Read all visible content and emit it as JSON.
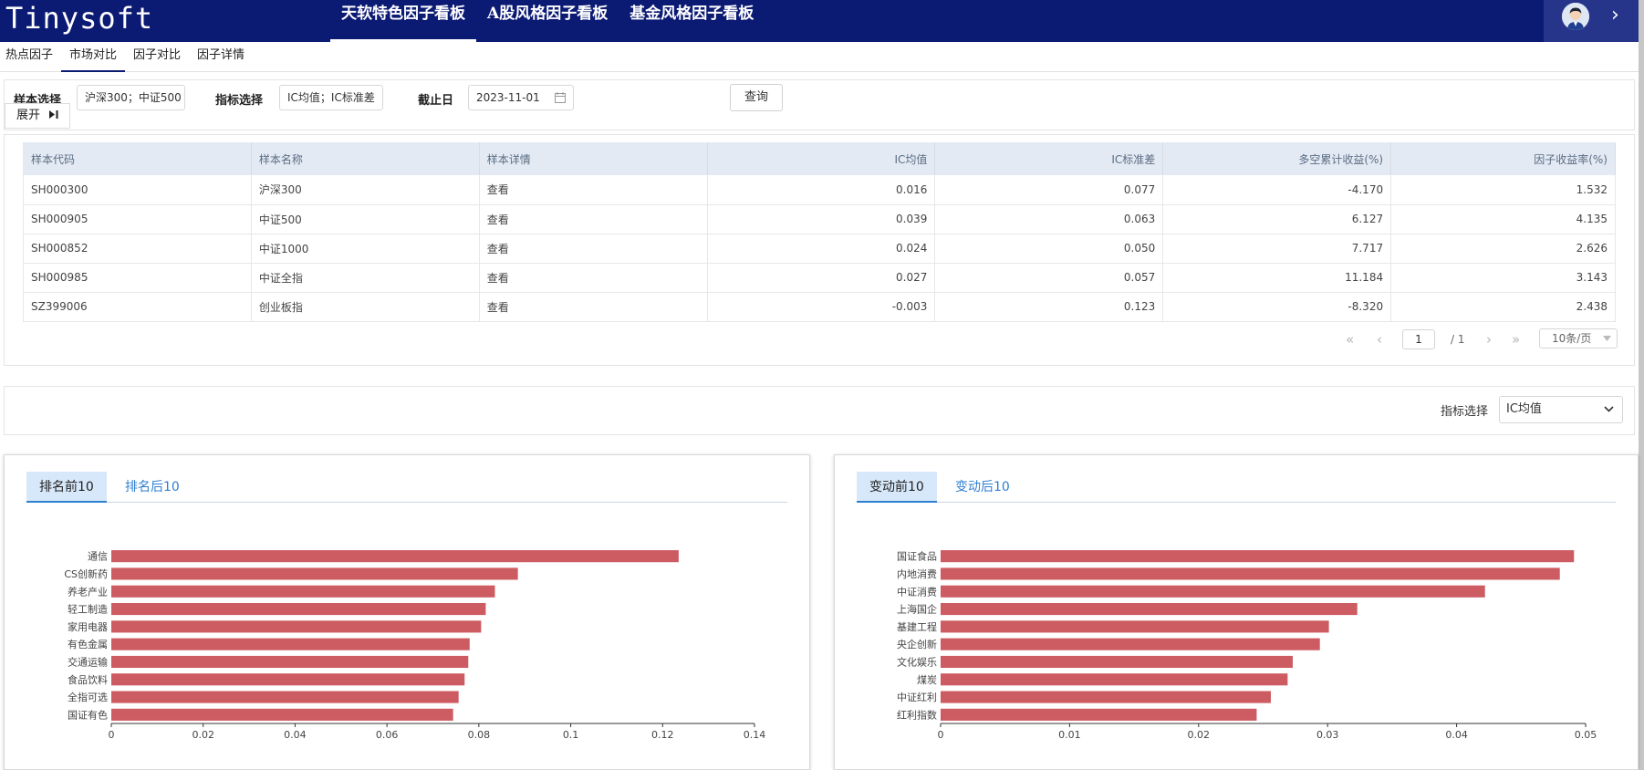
{
  "app": {
    "logo": "Tinysoft"
  },
  "nav": [
    {
      "label": "天软特色因子看板"
    },
    {
      "label": "A股风格因子看板"
    },
    {
      "label": "基金风格因子看板"
    }
  ],
  "subtabs": [
    {
      "label": "热点因子"
    },
    {
      "label": "市场对比"
    },
    {
      "label": "因子对比"
    },
    {
      "label": "因子详情"
    }
  ],
  "filters": {
    "sample_label": "样本选择",
    "sample_value": "沪深300；中证500",
    "metric_label": "指标选择",
    "metric_value": "IC均值；IC标准差",
    "date_label": "截止日",
    "date_value": "2023-11-01",
    "query_button": "查询",
    "expand_label": "展开"
  },
  "table": {
    "headers": [
      "样本代码",
      "样本名称",
      "样本详情",
      "IC均值",
      "IC标准差",
      "多空累计收益(%)",
      "因子收益率(%)"
    ],
    "rows": [
      {
        "code": "SH000300",
        "name": "沪深300",
        "detail": "查看",
        "ic_mean": "0.016",
        "ic_std": "0.077",
        "ls_return": "-4.170",
        "factor_return": "1.532"
      },
      {
        "code": "SH000905",
        "name": "中证500",
        "detail": "查看",
        "ic_mean": "0.039",
        "ic_std": "0.063",
        "ls_return": "6.127",
        "factor_return": "4.135"
      },
      {
        "code": "SH000852",
        "name": "中证1000",
        "detail": "查看",
        "ic_mean": "0.024",
        "ic_std": "0.050",
        "ls_return": "7.717",
        "factor_return": "2.626"
      },
      {
        "code": "SH000985",
        "name": "中证全指",
        "detail": "查看",
        "ic_mean": "0.027",
        "ic_std": "0.057",
        "ls_return": "11.184",
        "factor_return": "3.143"
      },
      {
        "code": "SZ399006",
        "name": "创业板指",
        "detail": "查看",
        "ic_mean": "-0.003",
        "ic_std": "0.123",
        "ls_return": "-8.320",
        "factor_return": "2.438"
      }
    ]
  },
  "pagination": {
    "first": "«",
    "prev": "‹",
    "page": "1",
    "total": "/ 1",
    "next": "›",
    "last": "»",
    "page_size": "10条/页"
  },
  "indicator": {
    "label": "指标选择",
    "value": "IC均值"
  },
  "colors": {
    "header_bg": "#0b1a73",
    "bar": "#cd5c62",
    "link": "#2f7fd1",
    "negative": "#e0141e"
  },
  "chart_data": [
    {
      "type": "bar",
      "orientation": "horizontal",
      "tabs": [
        "排名前10",
        "排名后10"
      ],
      "active_tab": "排名前10",
      "categories": [
        "通信",
        "CS创新药",
        "养老产业",
        "轻工制造",
        "家用电器",
        "有色金属",
        "交通运输",
        "食品饮料",
        "全指可选",
        "国证有色"
      ],
      "values": [
        0.1235,
        0.0885,
        0.0835,
        0.0815,
        0.0805,
        0.078,
        0.0777,
        0.0769,
        0.0756,
        0.0744
      ],
      "xlim": [
        0,
        0.14
      ],
      "xticks": [
        "0",
        "0.02",
        "0.04",
        "0.06",
        "0.08",
        "0.1",
        "0.12",
        "0.14"
      ],
      "bar_color": "#cd5c62"
    },
    {
      "type": "bar",
      "orientation": "horizontal",
      "tabs": [
        "变动前10",
        "变动后10"
      ],
      "active_tab": "变动前10",
      "categories": [
        "国证食品",
        "内地消费",
        "中证消费",
        "上海国企",
        "基建工程",
        "央企创新",
        "文化娱乐",
        "煤炭",
        "中证红利",
        "红利指数"
      ],
      "values": [
        0.0491,
        0.048,
        0.0422,
        0.0323,
        0.0301,
        0.0294,
        0.0273,
        0.0269,
        0.0256,
        0.0245
      ],
      "xlim": [
        0,
        0.05
      ],
      "xticks": [
        "0",
        "0.01",
        "0.02",
        "0.03",
        "0.04",
        "0.05"
      ],
      "bar_color": "#cd5c62"
    }
  ]
}
